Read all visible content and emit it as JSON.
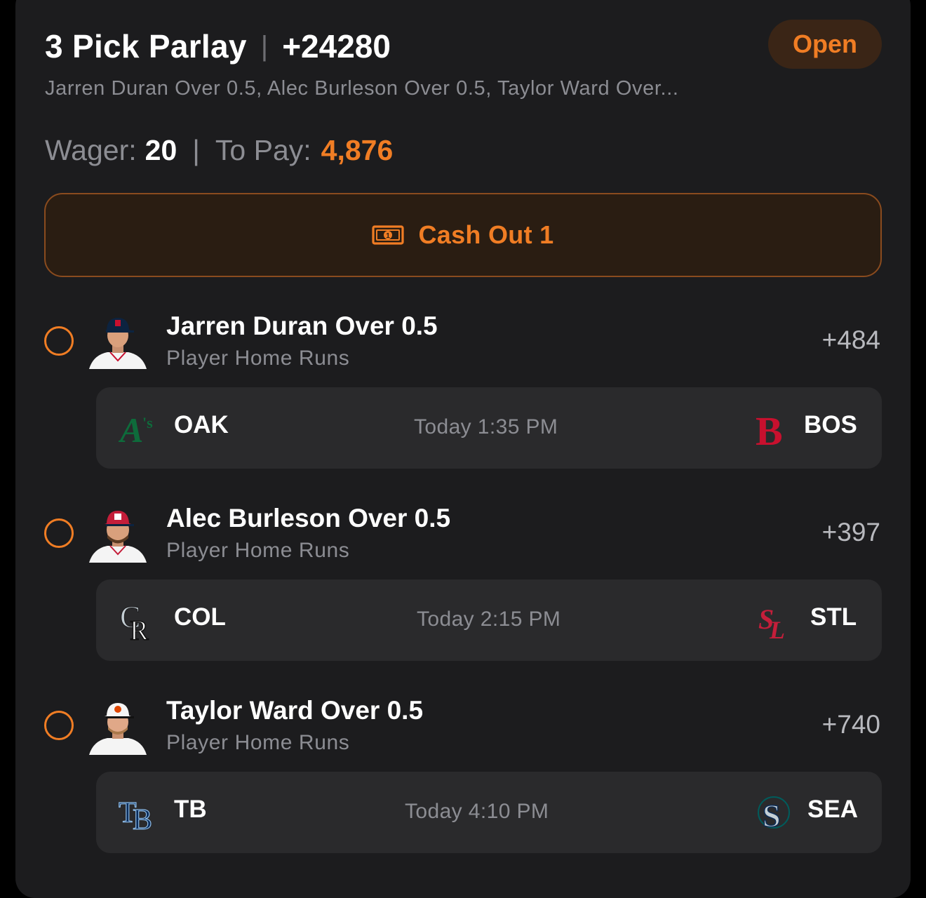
{
  "header": {
    "title": "3 Pick Parlay",
    "separator": "|",
    "odds": "+24280",
    "status": "Open",
    "legs_summary": "Jarren Duran Over 0.5, Alec Burleson Over 0.5, Taylor Ward Over..."
  },
  "wager": {
    "wager_label": "Wager:",
    "wager_value": "20",
    "separator": "|",
    "payout_label": "To Pay:",
    "payout_value": "4,876"
  },
  "cashout": {
    "label": "Cash Out 1",
    "icon": "cash-bill-icon"
  },
  "colors": {
    "accent": "#f07d24",
    "card_bg": "#1c1c1e",
    "game_bg": "#2a2a2c",
    "muted_text": "#8c8d93"
  },
  "legs": [
    {
      "pick": "Jarren Duran Over 0.5",
      "market": "Player Home Runs",
      "odds": "+484",
      "away": {
        "abbr": "OAK",
        "logo": "athletics-logo"
      },
      "home": {
        "abbr": "BOS",
        "logo": "red-sox-logo"
      },
      "time": "Today 1:35 PM"
    },
    {
      "pick": "Alec Burleson Over 0.5",
      "market": "Player Home Runs",
      "odds": "+397",
      "away": {
        "abbr": "COL",
        "logo": "rockies-logo"
      },
      "home": {
        "abbr": "STL",
        "logo": "cardinals-logo"
      },
      "time": "Today 2:15 PM"
    },
    {
      "pick": "Taylor Ward Over 0.5",
      "market": "Player Home Runs",
      "odds": "+740",
      "away": {
        "abbr": "TB",
        "logo": "rays-logo"
      },
      "home": {
        "abbr": "SEA",
        "logo": "mariners-logo"
      },
      "time": "Today 4:10 PM"
    }
  ]
}
